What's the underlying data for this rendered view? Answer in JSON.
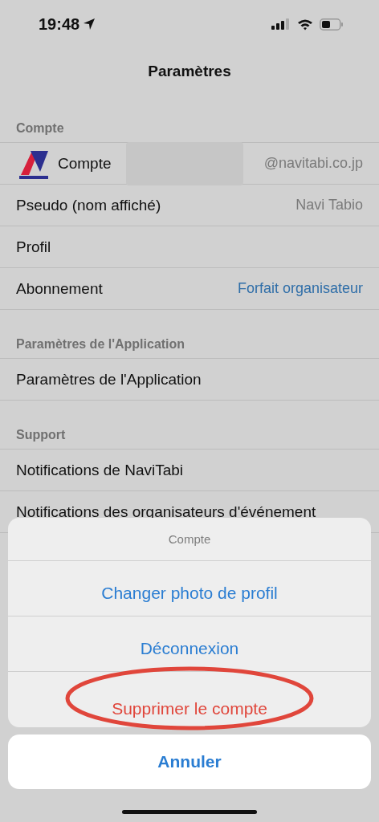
{
  "status_bar": {
    "time": "19:48"
  },
  "nav": {
    "title": "Paramètres"
  },
  "sections": [
    {
      "header": "Compte",
      "rows": [
        {
          "kind": "account",
          "label": "Compte",
          "value": "@navitabi.co.jp"
        },
        {
          "kind": "detail",
          "label": "Pseudo (nom affiché)",
          "value": "Navi Tabio"
        },
        {
          "kind": "plain",
          "label": "Profil"
        },
        {
          "kind": "link",
          "label": "Abonnement",
          "value": "Forfait organisateur"
        }
      ]
    },
    {
      "header": "Paramètres de l'Application",
      "rows": [
        {
          "kind": "plain",
          "label": "Paramètres de l'Application"
        }
      ]
    },
    {
      "header": "Support",
      "rows": [
        {
          "kind": "plain",
          "label": "Notifications de NaviTabi"
        },
        {
          "kind": "plain",
          "label": "Notifications des organisateurs d'événement"
        }
      ]
    }
  ],
  "action_sheet": {
    "title": "Compte",
    "actions": [
      {
        "label": "Changer photo de profil",
        "kind": "default",
        "circled": false
      },
      {
        "label": "Déconnexion",
        "kind": "default",
        "circled": false
      },
      {
        "label": "Supprimer le compte",
        "kind": "destructive",
        "circled": true
      }
    ],
    "cancel": "Annuler"
  }
}
